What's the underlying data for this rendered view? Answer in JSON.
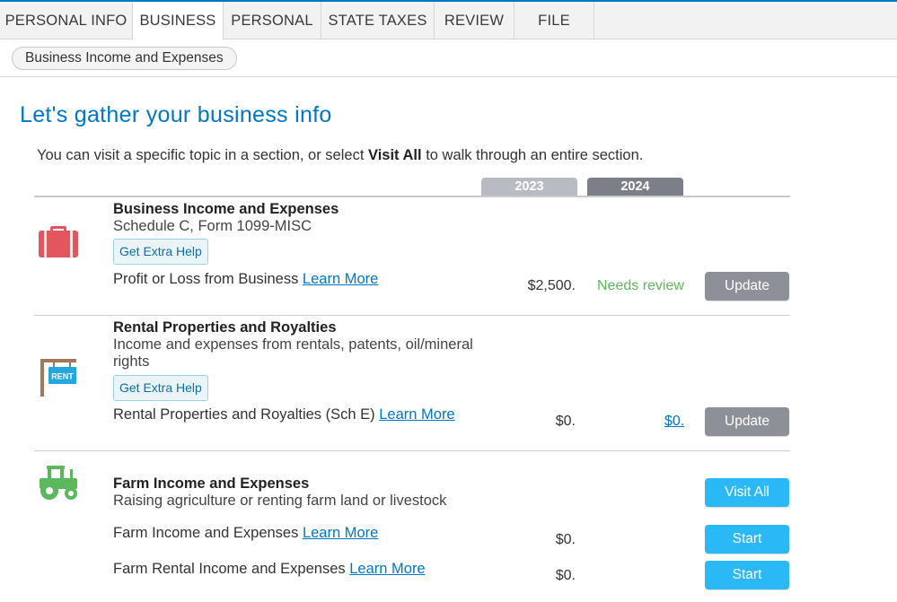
{
  "tabs": [
    {
      "label": "PERSONAL INFO"
    },
    {
      "label": "BUSINESS",
      "active": true
    },
    {
      "label": "PERSONAL"
    },
    {
      "label": "STATE TAXES"
    },
    {
      "label": "REVIEW"
    },
    {
      "label": "FILE"
    }
  ],
  "breadcrumb": "Business Income and Expenses",
  "heading": "Let's gather your business info",
  "intro": {
    "before": "You can visit a specific topic in a section, or select ",
    "bold": "Visit All",
    "after": " to walk through an entire section."
  },
  "years": {
    "prior": "2023",
    "current": "2024"
  },
  "colors": {
    "accent": "#0077c5",
    "update_button": "#8d9096",
    "start_button": "#2ab8f6",
    "needs_review": "#5cb85c"
  },
  "sections": [
    {
      "icon": "briefcase-icon",
      "title": "Business Income and Expenses",
      "subtitle": "Schedule C, Form 1099-MISC",
      "help": "Get Extra Help",
      "items": [
        {
          "label": "Profit or Loss from Business",
          "learn": "Learn More",
          "amount_2023": "$2,500.",
          "status_2024": "Needs review",
          "button": "Update"
        }
      ]
    },
    {
      "icon": "rent-sign-icon",
      "title": "Rental Properties and Royalties",
      "subtitle": "Income and expenses from rentals, patents, oil/mineral rights",
      "subtitle_line1": "Income and expenses from rentals, patents, oil/mineral",
      "subtitle_line2": "rights",
      "help": "Get Extra Help",
      "rent_sign_text": "RENT",
      "items": [
        {
          "label": "Rental Properties and Royalties (Sch E)",
          "learn": "Learn More",
          "amount_2023": "$0.",
          "status_2024": "$0.",
          "button": "Update"
        }
      ]
    },
    {
      "icon": "tractor-icon",
      "title": "Farm Income and Expenses",
      "subtitle": "Raising agriculture or renting farm land or livestock",
      "visit_all": "Visit All",
      "items": [
        {
          "label": "Farm Income and Expenses",
          "learn": "Learn More",
          "amount_2023": "$0.",
          "button": "Start"
        },
        {
          "label": "Farm Rental Income and Expenses",
          "learn": "Learn More",
          "amount_2023": "$0.",
          "button": "Start"
        }
      ]
    }
  ]
}
